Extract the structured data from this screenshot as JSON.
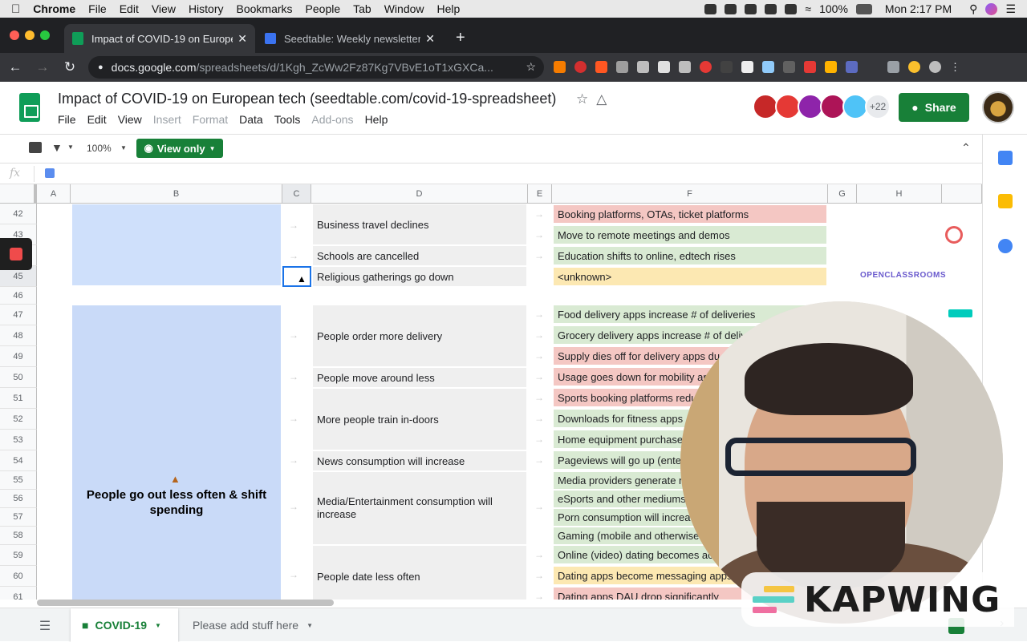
{
  "mac_menubar": {
    "app": "Chrome",
    "items": [
      "File",
      "Edit",
      "View",
      "History",
      "Bookmarks",
      "People",
      "Tab",
      "Window",
      "Help"
    ],
    "battery": "100%",
    "clock": "Mon 2:17 PM"
  },
  "browser": {
    "tabs": [
      {
        "title": "Impact of COVID-19 on Europe",
        "favicon_color": "#0f9d58",
        "active": true
      },
      {
        "title": "Seedtable: Weekly newsletter",
        "favicon_color": "#3b73f0",
        "active": false
      }
    ],
    "url_host": "docs.google.com",
    "url_rest": "/spreadsheets/d/1Kgh_ZcWw2Fz87Kg7VBvE1oT1xGXCa..."
  },
  "doc": {
    "title": "Impact of COVID-19 on European tech (seedtable.com/covid-19-spreadsheet)",
    "menu": [
      {
        "label": "File",
        "disabled": false
      },
      {
        "label": "Edit",
        "disabled": false
      },
      {
        "label": "View",
        "disabled": false
      },
      {
        "label": "Insert",
        "disabled": true
      },
      {
        "label": "Format",
        "disabled": true
      },
      {
        "label": "Data",
        "disabled": false
      },
      {
        "label": "Tools",
        "disabled": false
      },
      {
        "label": "Add-ons",
        "disabled": true
      },
      {
        "label": "Help",
        "disabled": false
      }
    ],
    "collaborators_more": "+22",
    "share_label": "Share"
  },
  "toolbar": {
    "zoom": "100%",
    "view_only_label": "View only"
  },
  "formula_bar": {
    "fx": "fx"
  },
  "columns": [
    "A",
    "B",
    "C",
    "D",
    "E",
    "F",
    "G",
    "H"
  ],
  "rows": [
    "42",
    "43",
    "44",
    "45",
    "46",
    "47",
    "48",
    "49",
    "50",
    "51",
    "52",
    "53",
    "54",
    "55",
    "56",
    "57",
    "58",
    "59",
    "60",
    "61"
  ],
  "cells": {
    "b_group": "People go out less often & shift spending",
    "d": [
      "Business travel declines",
      "Schools are cancelled",
      "Religious gatherings go down",
      "People order more delivery",
      "People move around less",
      "More people train in-doors",
      "News consumption will increase",
      "Media/Entertainment consumption will increase",
      "People date less often"
    ],
    "f": [
      {
        "text": "Booking platforms, OTAs, ticket platforms",
        "color": "#f4c7c3"
      },
      {
        "text": "Move to remote meetings and demos",
        "color": "#d9ead3"
      },
      {
        "text": "Education shifts to online, edtech rises",
        "color": "#d9ead3"
      },
      {
        "text": "<unknown>",
        "color": "#fce8b2"
      },
      {
        "text": "Food delivery apps increase # of deliveries",
        "color": "#d9ead3"
      },
      {
        "text": "Grocery delivery apps increase # of deliv",
        "color": "#d9ead3"
      },
      {
        "text": "Supply dies off for delivery apps du",
        "color": "#f4c7c3"
      },
      {
        "text": "Usage goes down for mobility ar",
        "color": "#f4c7c3"
      },
      {
        "text": "Sports booking platforms redu",
        "color": "#f4c7c3"
      },
      {
        "text": "Downloads for fitness apps",
        "color": "#d9ead3"
      },
      {
        "text": "Home equipment purchase",
        "color": "#d9ead3"
      },
      {
        "text": "Pageviews will go up (enter",
        "color": "#d9ead3"
      },
      {
        "text": "Media providers generate n",
        "color": "#d9ead3"
      },
      {
        "text": "eSports and other mediums",
        "color": "#d9ead3"
      },
      {
        "text": "Porn consumption will increa",
        "color": "#d9ead3"
      },
      {
        "text": "Gaming (mobile and otherwise",
        "color": "#d9ead3"
      },
      {
        "text": "Online (video) dating becomes ac",
        "color": "#d9ead3"
      },
      {
        "text": "Dating apps become messaging apps",
        "color": "#fce8b2"
      },
      {
        "text": "Dating apps DAU drop significantly",
        "color": "#f4c7c3"
      }
    ],
    "h_logo_openclassrooms": "OPENCLASSROOMS"
  },
  "sheet_tabs": [
    "COVID-19",
    "Please add stuff here"
  ],
  "overlay": {
    "brand": "KAPWING"
  },
  "colors": {
    "sheets_green": "#188038",
    "group_blue": "#c9daf8",
    "group_blue_top": "#cfe0fb"
  }
}
